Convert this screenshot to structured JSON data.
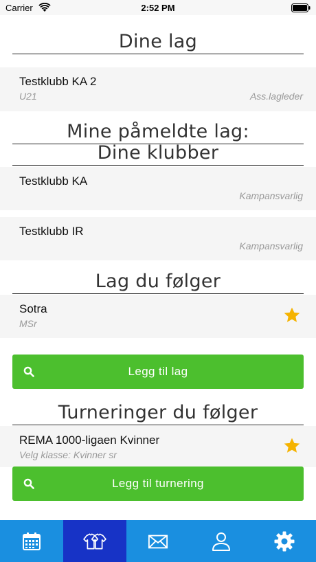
{
  "status_bar": {
    "carrier": "Carrier",
    "time": "2:52 PM"
  },
  "sections": {
    "my_teams": "Dine lag",
    "registered_teams": "Mine påmeldte lag:",
    "my_clubs": "Dine klubber",
    "followed_teams": "Lag du følger",
    "followed_tournaments": "Turneringer du følger"
  },
  "my_teams": [
    {
      "name": "Testklubb KA 2",
      "class": "U21",
      "role": "Ass.lagleder"
    }
  ],
  "my_clubs": [
    {
      "name": "Testklubb KA",
      "role": "Kampansvarlig"
    },
    {
      "name": "Testklubb IR",
      "role": "Kampansvarlig"
    }
  ],
  "followed_teams": [
    {
      "name": "Sotra",
      "class": "MSr"
    }
  ],
  "followed_tournaments": [
    {
      "name": "REMA 1000-ligaen Kvinner",
      "class": "Velg klasse: Kvinner sr"
    }
  ],
  "buttons": {
    "add_team": "Legg til lag",
    "add_tournament": "Legg til turnering"
  },
  "tabbar": {
    "active_index": 1,
    "tabs": [
      {
        "icon": "calendar-icon"
      },
      {
        "icon": "jerseys-icon"
      },
      {
        "icon": "mail-icon"
      },
      {
        "icon": "user-icon"
      },
      {
        "icon": "gear-icon"
      }
    ]
  },
  "colors": {
    "accent_green": "#4cbf2e",
    "tabbar_blue": "#1a8fe0",
    "tab_active": "#1733c6",
    "star": "#f5b301"
  }
}
